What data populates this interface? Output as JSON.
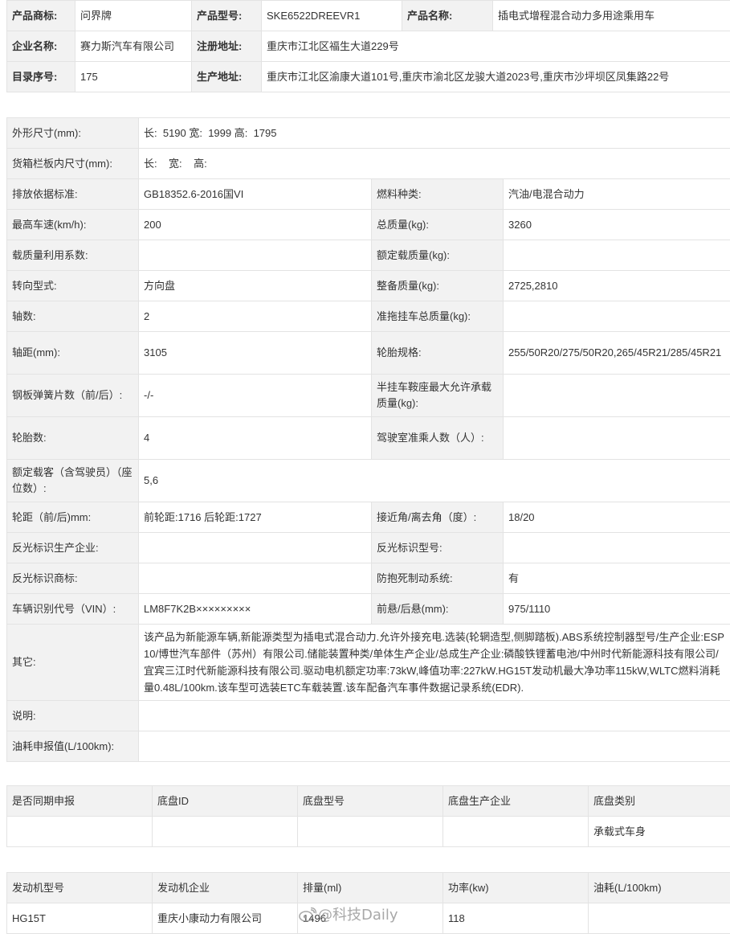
{
  "header_info": {
    "brand_label": "产品商标:",
    "brand_value": "问界牌",
    "model_label": "产品型号:",
    "model_value": "SKE6522DREEVR1",
    "name_label": "产品名称:",
    "name_value": "插电式增程混合动力多用途乘用车",
    "company_label": "企业名称:",
    "company_value": "赛力斯汽车有限公司",
    "reg_addr_label": "注册地址:",
    "reg_addr_value": "重庆市江北区福生大道229号",
    "catalog_label": "目录序号:",
    "catalog_value": "175",
    "prod_addr_label": "生产地址:",
    "prod_addr_value": "重庆市江北区渝康大道101号,重庆市渝北区龙骏大道2023号,重庆市沙坪坝区凤集路22号"
  },
  "specs": {
    "dim_label": "外形尺寸(mm):",
    "dim_value": "长:  5190 宽:  1999 高:  1795",
    "cargo_label": "货箱栏板内尺寸(mm):",
    "cargo_value": "长:    宽:    高:",
    "emission_label": "排放依据标准:",
    "emission_value": "GB18352.6-2016国VI",
    "fuel_label": "燃料种类:",
    "fuel_value": "汽油/电混合动力",
    "speed_label": "最高车速(km/h):",
    "speed_value": "200",
    "total_mass_label": "总质量(kg):",
    "total_mass_value": "3260",
    "load_util_label": "载质量利用系数:",
    "load_util_value": "",
    "rated_load_label": "额定载质量(kg):",
    "rated_load_value": "",
    "steering_label": "转向型式:",
    "steering_value": "方向盘",
    "curb_label": "整备质量(kg):",
    "curb_value": "2725,2810",
    "axles_label": "轴数:",
    "axles_value": "2",
    "trailer_label": "准拖挂车总质量(kg):",
    "trailer_value": "",
    "wheelbase_label": "轴距(mm):",
    "wheelbase_value": "3105",
    "tire_spec_label": "轮胎规格:",
    "tire_spec_value": "255/50R20/275/50R20,265/45R21/285/45R21",
    "leaf_label": "钢板弹簧片数（前/后）:",
    "leaf_value": "-/-",
    "saddle_label": "半挂车鞍座最大允许承载质量(kg):",
    "saddle_value": "",
    "tires_label": "轮胎数:",
    "tires_value": "4",
    "cab_label": "驾驶室准乘人数（人）:",
    "cab_value": "",
    "seats_label": "额定载客（含驾驶员）（座位数）:",
    "seats_value": "5,6",
    "track_label": "轮距（前/后)mm:",
    "track_value": "前轮距:1716 后轮距:1727",
    "angle_label": "接近角/离去角（度）:",
    "angle_value": "18/20",
    "refl_maker_label": "反光标识生产企业:",
    "refl_maker_value": "",
    "refl_model_label": "反光标识型号:",
    "refl_model_value": "",
    "refl_brand_label": "反光标识商标:",
    "refl_brand_value": "",
    "abs_label": "防抱死制动系统:",
    "abs_value": "有",
    "vin_label": "车辆识别代号（VIN）:",
    "vin_value": "LM8F7K2B×××××××××",
    "overhang_label": "前悬/后悬(mm):",
    "overhang_value": "975/1110",
    "other_label": "其它:",
    "other_value": "该产品为新能源车辆,新能源类型为插电式混合动力.允许外接充电.选装(轮辋造型,侧脚踏板).ABS系统控制器型号/生产企业:ESP10/博世汽车部件（苏州）有限公司.储能装置种类/单体生产企业/总成生产企业:磷酸铁锂蓄电池/中州时代新能源科技有限公司/宜宾三江时代新能源科技有限公司.驱动电机额定功率:73kW,峰值功率:227kW.HG15T发动机最大净功率115kW,WLTC燃料消耗量0.48L/100km.该车型可选装ETC车载装置.该车配备汽车事件数据记录系统(EDR).",
    "note_label": "说明:",
    "note_value": "",
    "fuel_decl_label": "油耗申报值(L/100km):",
    "fuel_decl_value": ""
  },
  "chassis": {
    "headers": [
      "是否同期申报",
      "底盘ID",
      "底盘型号",
      "底盘生产企业",
      "底盘类别"
    ],
    "row": [
      "",
      "",
      "",
      "",
      "承载式车身"
    ]
  },
  "engine": {
    "headers": [
      "发动机型号",
      "发动机企业",
      "排量(ml)",
      "功率(kw)",
      "油耗(L/100km)"
    ],
    "row": [
      "HG15T",
      "重庆小康动力有限公司",
      "1496",
      "118",
      ""
    ]
  },
  "watermark": "@科技Daily"
}
